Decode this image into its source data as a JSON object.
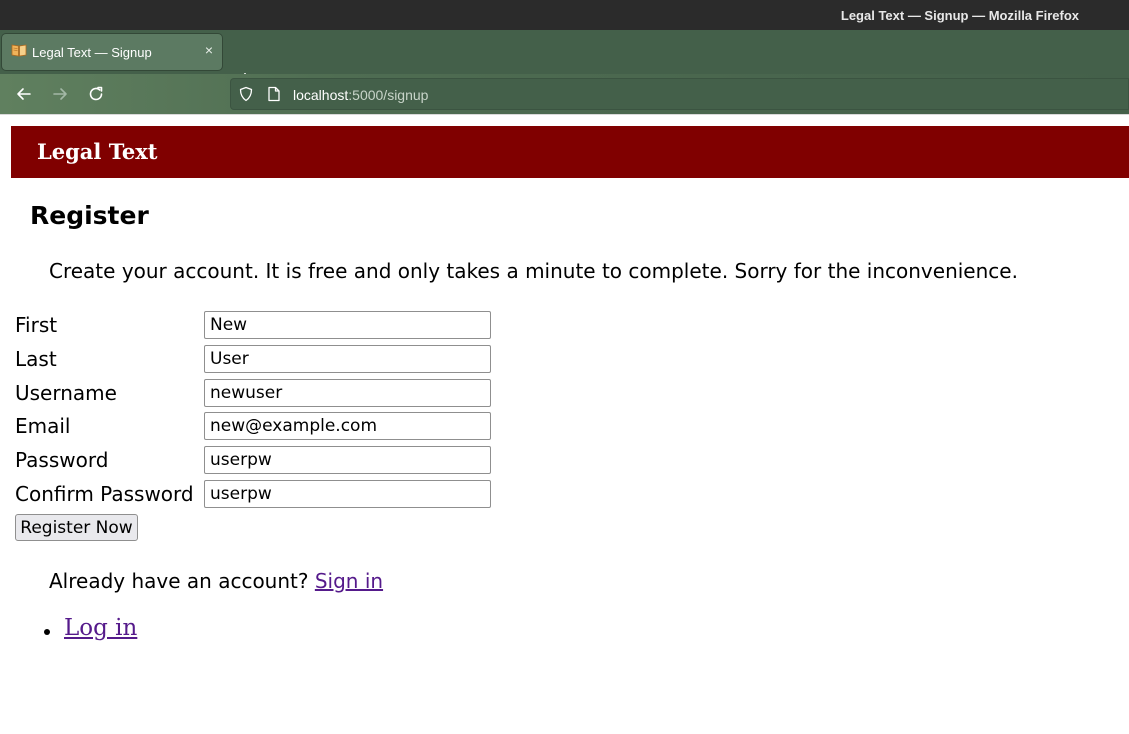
{
  "window": {
    "title": "Legal Text — Signup — Mozilla Firefox"
  },
  "tab": {
    "label": "Legal Text — Signup",
    "close_symbol": "×",
    "favicon": "book-icon"
  },
  "newtab": {
    "symbol": "+"
  },
  "urlbar": {
    "host": "localhost",
    "path": ":5000/signup"
  },
  "site": {
    "brand": "Legal Text",
    "brand_color": "#800000"
  },
  "page": {
    "heading": "Register",
    "intro": "Create your account. It is free and only takes a minute to complete. Sorry for the inconvenience."
  },
  "form": {
    "fields": [
      {
        "label": "First",
        "value": "New"
      },
      {
        "label": "Last",
        "value": "User"
      },
      {
        "label": "Username",
        "value": "newuser"
      },
      {
        "label": "Email",
        "value": "new@example.com"
      },
      {
        "label": "Password",
        "value": "userpw"
      },
      {
        "label": "Confirm Password",
        "value": "userpw"
      }
    ],
    "submit_label": "Register Now"
  },
  "signin": {
    "prompt": "Already have an account?",
    "link_text": "Sign in"
  },
  "nav": {
    "items": [
      {
        "label": "Log in"
      }
    ]
  }
}
